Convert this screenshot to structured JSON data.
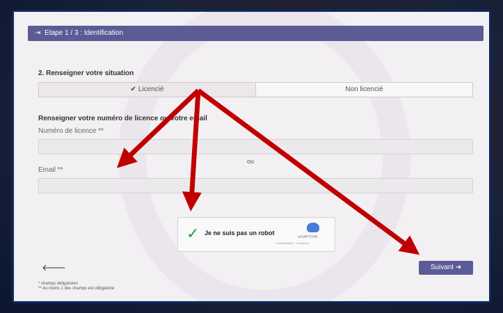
{
  "step": {
    "icon": "login-icon",
    "label": "Etape 1 / 3 : Identification"
  },
  "situation": {
    "title": "2. Renseigner votre situation",
    "options": [
      {
        "label": "Licencié",
        "selected": true
      },
      {
        "label": "Non licencié",
        "selected": false
      }
    ]
  },
  "identification": {
    "title": "Renseigner votre numéro de licence ou votre email",
    "license_label": "Numéro de licence **",
    "license_value": "",
    "separator": "ou",
    "email_label": "Email **",
    "email_value": ""
  },
  "captcha": {
    "label": "Je ne suis pas un robot",
    "brand": "reCAPTCHA",
    "legal": "Confidentialité - Conditions",
    "checked": true
  },
  "nav": {
    "back_icon": "arrow-left-icon",
    "next_label": "Suivant",
    "next_icon": "arrow-right-icon"
  },
  "notes": {
    "required": "* champs obligatoires",
    "one_required": "** Au moins 1 des champs est obligatoire"
  },
  "colors": {
    "accent": "#5b5b96",
    "arrow": "#c00000",
    "frame": "#0d2a5c"
  }
}
